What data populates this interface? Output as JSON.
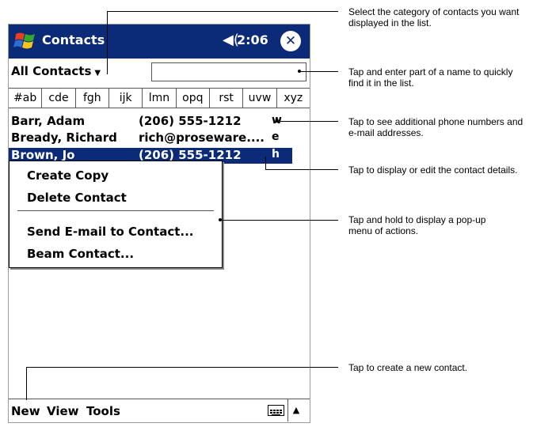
{
  "window": {
    "title": "Contacts",
    "time": "2:06",
    "speaker_glyph": "◀(",
    "close_glyph": "✕"
  },
  "category": {
    "label": "All Contacts",
    "arrow": "▼"
  },
  "find_box": {
    "value": ""
  },
  "letter_tabs": [
    "#ab",
    "cde",
    "fgh",
    "ijk",
    "lmn",
    "opq",
    "rst",
    "uvw",
    "xyz"
  ],
  "contacts": [
    {
      "name": "Barr, Adam",
      "value": "(206) 555-1212",
      "type": "w"
    },
    {
      "name": "Bready, Richard",
      "value": "rich@proseware....",
      "type": "e"
    },
    {
      "name": "Brown, Jo",
      "value": "(206) 555-1212",
      "type": "h",
      "selected": true
    }
  ],
  "popup_menu": [
    "Create Copy",
    "Delete Contact",
    "Send E-mail to Contact...",
    "Beam Contact..."
  ],
  "bottom_bar": [
    "New",
    "View",
    "Tools"
  ],
  "callouts": [
    "Select the category of contacts you want displayed in the list.",
    "Tap and enter part of a name to quickly find it in the list.",
    "Tap to see additional phone numbers and e-mail addresses.",
    "Tap to display or edit the contact details.",
    "Tap and hold to display a pop-up menu of actions.",
    "Tap to create a new contact."
  ],
  "colors": {
    "titlebar": "#0b2a78",
    "selection": "#0b2a78"
  },
  "icons": [
    "windows-start-icon",
    "speaker-icon",
    "close-icon",
    "keyboard-icon",
    "up-arrow-icon"
  ]
}
